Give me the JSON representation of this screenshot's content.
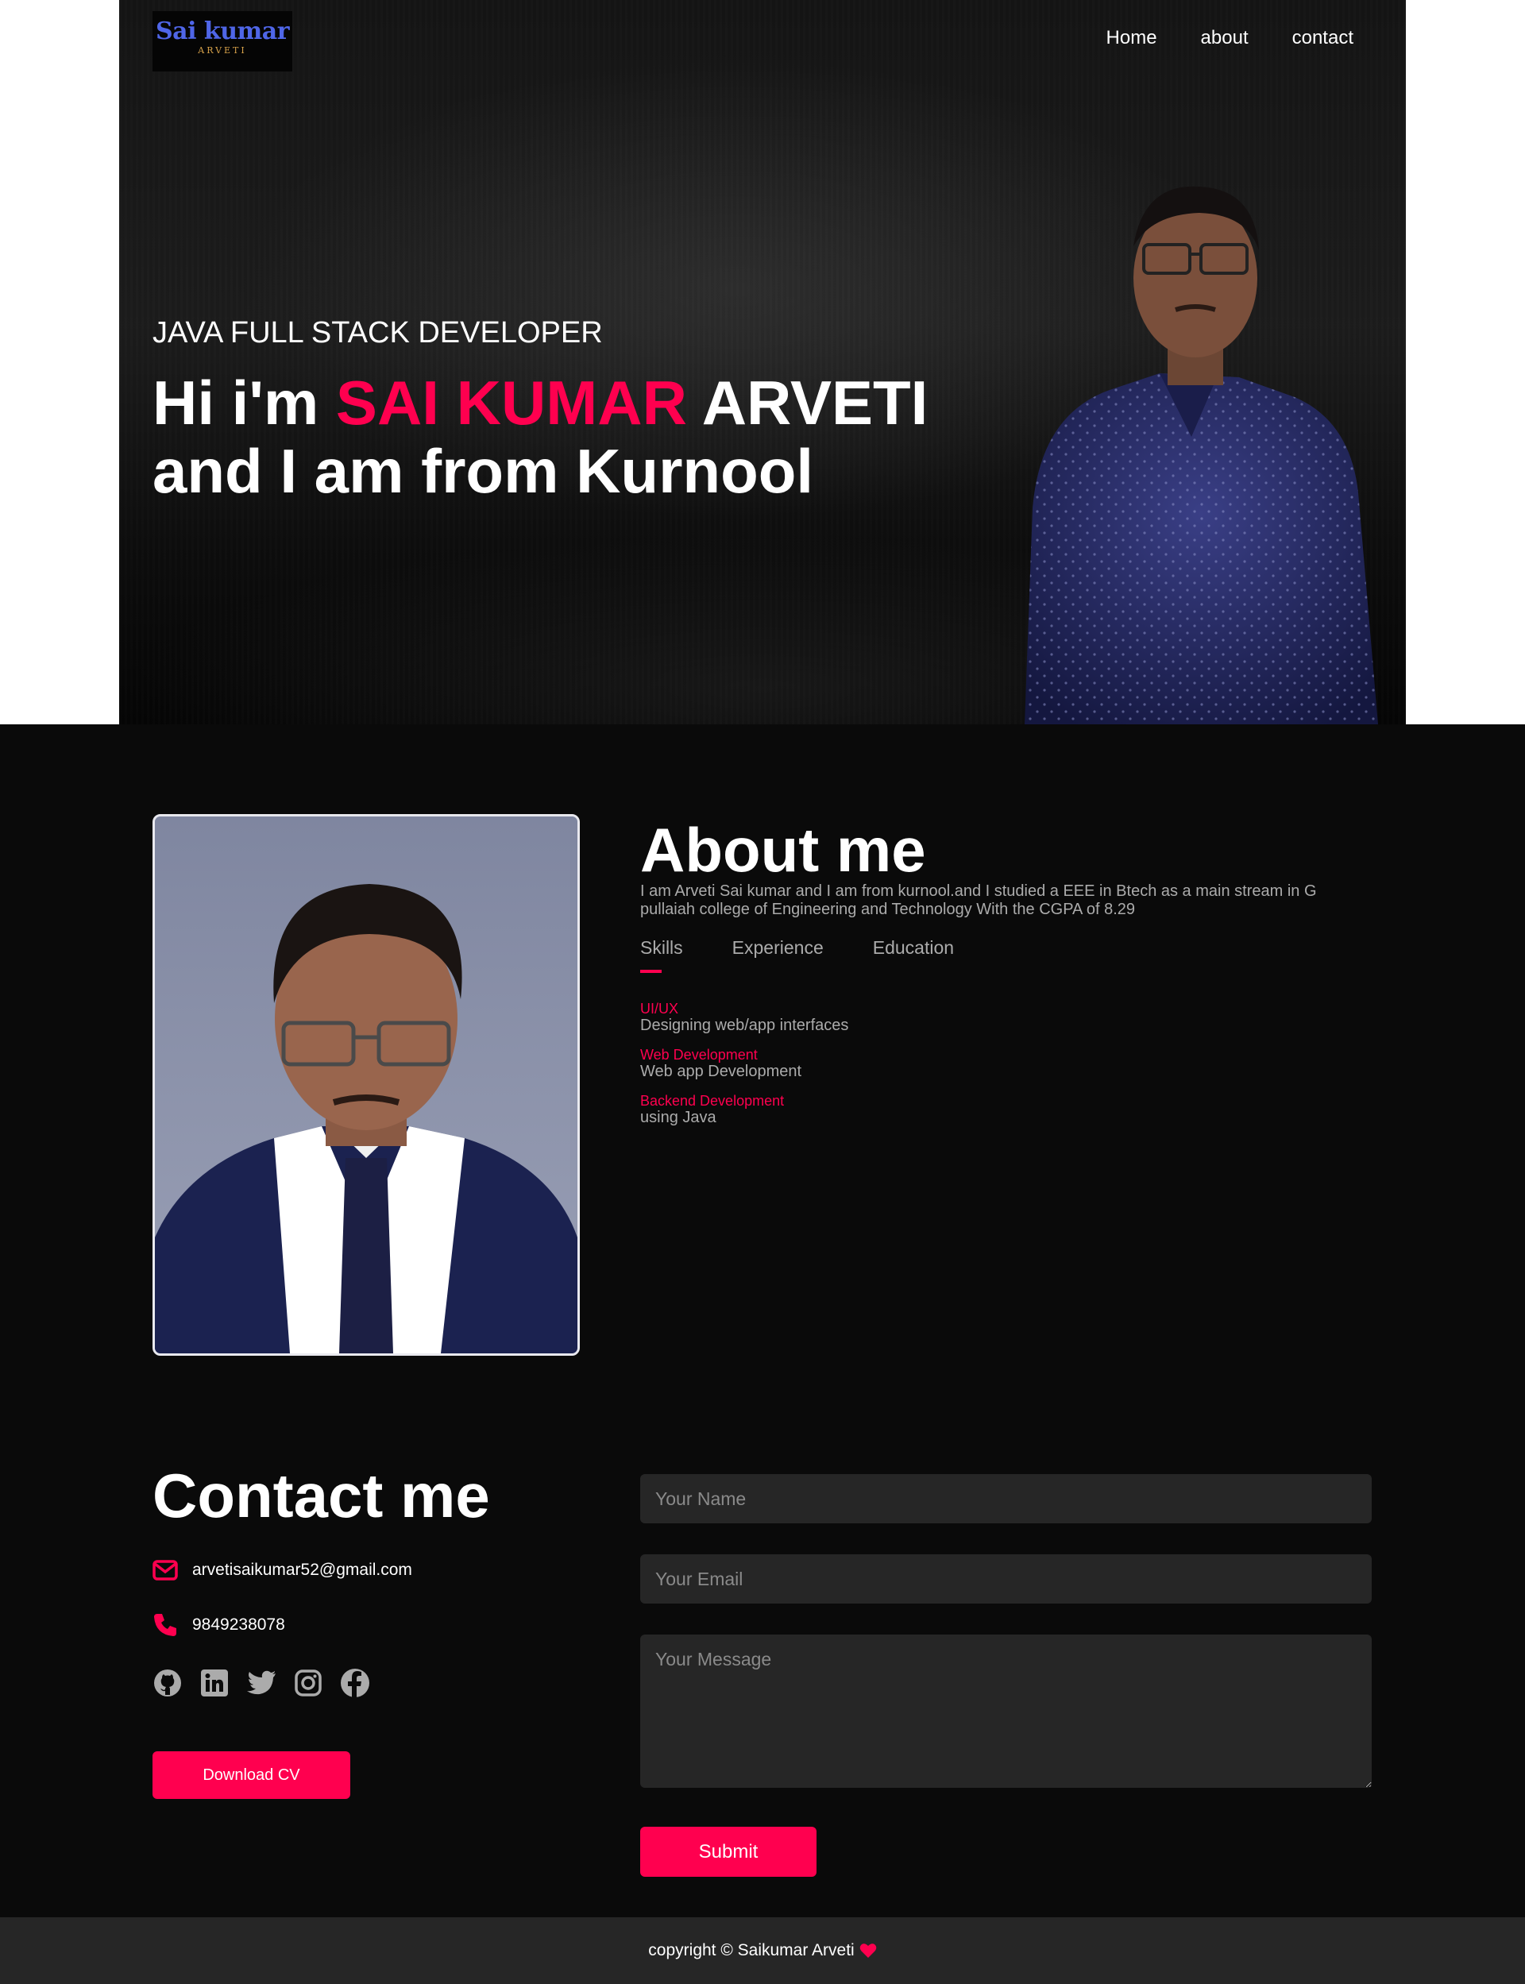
{
  "header": {
    "logo_main": "Sai kumar",
    "logo_sub": "ARVETI",
    "nav": [
      "Home",
      "about",
      "contact"
    ]
  },
  "hero": {
    "subtitle": "JAVA FULL STACK DEVELOPER",
    "greeting": "Hi i'm ",
    "name_highlight": "SAI KUMAR",
    "name_rest": " ARVETI",
    "line2": "and I am from Kurnool"
  },
  "about": {
    "title": "About me",
    "text": "I am Arveti Sai kumar and I am from kurnool.and I studied a EEE in Btech as a main stream in G pullaiah college of Engineering and Technology With the CGPA of 8.29",
    "tabs": [
      "Skills",
      "Experience",
      "Education"
    ],
    "skills": [
      {
        "name": "UI/UX",
        "desc": "Designing web/app interfaces"
      },
      {
        "name": "Web Development",
        "desc": "Web app Development"
      },
      {
        "name": "Backend Development",
        "desc": "using Java"
      }
    ]
  },
  "contact": {
    "title": "Contact me",
    "email": "arvetisaikumar52@gmail.com",
    "phone": "9849238078",
    "socials": [
      "github-icon",
      "linkedin-icon",
      "twitter-icon",
      "instagram-icon",
      "facebook-icon"
    ],
    "download_label": "Download CV"
  },
  "form": {
    "name_placeholder": "Your Name",
    "email_placeholder": "Your Email",
    "message_placeholder": "Your Message",
    "submit_label": "Submit"
  },
  "footer": {
    "copyright": "copyright © Saikumar Arveti"
  },
  "colors": {
    "accent": "#ff004f",
    "logo_blue": "#4f66e8",
    "logo_gold": "#d7a24a",
    "muted_text": "#ababab",
    "field_bg": "#262626"
  }
}
